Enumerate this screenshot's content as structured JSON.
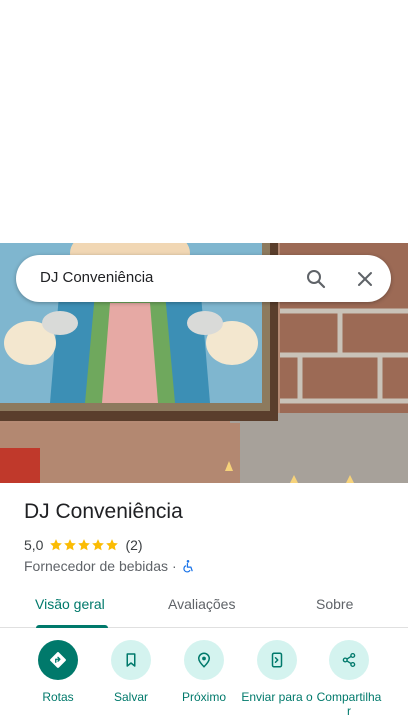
{
  "search": {
    "query": "DJ Conveniência"
  },
  "place": {
    "title": "DJ Conveniência",
    "rating": "5,0",
    "stars": 5,
    "review_count": "(2)",
    "category": "Fornecedor de bebidas",
    "separator": "·"
  },
  "tabs": [
    {
      "label": "Visão geral",
      "active": true
    },
    {
      "label": "Avaliações",
      "active": false
    },
    {
      "label": "Sobre",
      "active": false
    }
  ],
  "actions": [
    {
      "label": "Rotas",
      "icon": "directions-icon"
    },
    {
      "label": "Salvar",
      "icon": "bookmark-icon"
    },
    {
      "label": "Próximo",
      "icon": "nearby-icon"
    },
    {
      "label": "Enviar para o",
      "icon": "send-to-phone-icon"
    },
    {
      "label": "Compartilha r",
      "icon": "share-icon"
    }
  ],
  "colors": {
    "accent": "#00796b",
    "accent_light": "#d4f3ef",
    "star": "#fbbc04"
  }
}
